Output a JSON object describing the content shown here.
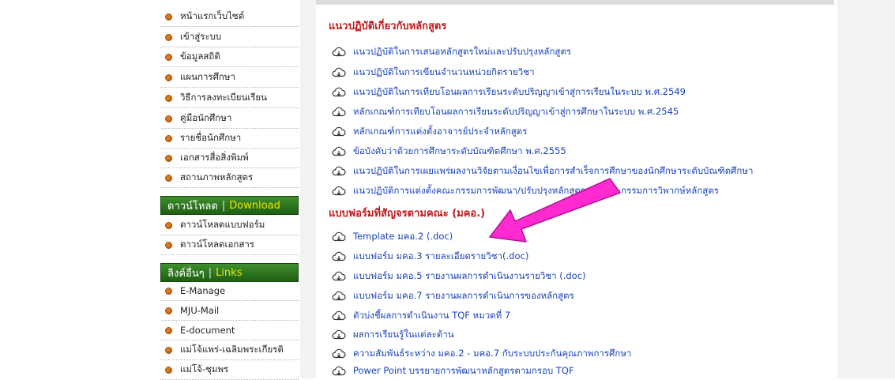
{
  "sidebar": {
    "items": [
      {
        "label": "หน้าแรกเว็บไซต์"
      },
      {
        "label": "เข้าสู่ระบบ"
      },
      {
        "label": "ข้อมูลสถิติ"
      },
      {
        "label": "แผนการศึกษา"
      },
      {
        "label": "วิธีการลงทะเบียนเรียน"
      },
      {
        "label": "คู่มือนักศึกษา"
      },
      {
        "label": "รายชื่อนักศึกษา"
      },
      {
        "label": "เอกสารสื่อสิ่งพิมพ์"
      },
      {
        "label": "สถานภาพหลักสูตร"
      }
    ],
    "download_header": {
      "th": "ดาวน์โหลด",
      "sep": "|",
      "en": "Download"
    },
    "download_items": [
      {
        "label": "ดาวน์โหลดแบบฟอร์ม"
      },
      {
        "label": "ดาวน์โหลดเอกสาร"
      }
    ],
    "links_header": {
      "th": "ลิงค์อื่นๆ",
      "sep": "|",
      "en": "Links"
    },
    "link_items": [
      {
        "label": "E-Manage"
      },
      {
        "label": "MJU-Mail"
      },
      {
        "label": "E-document"
      },
      {
        "label": "แม่โจ้แพร่-เฉลิมพระเกียรติ"
      },
      {
        "label": "แม่โจ้-ชุมพร"
      }
    ]
  },
  "main": {
    "section1_title": "แนวปฏิบัติเกี่ยวกับหลักสูตร",
    "section1_links": [
      {
        "label": "แนวปฏิบัติในการเสนอหลักสูตรใหม่และปรับปรุงหลักสูตร"
      },
      {
        "label": "แนวปฏิบัติในการเขียนจำนวนหน่วยกิตรายวิชา"
      },
      {
        "label": "แนวปฏิบัติในการเทียบโอนผลการเรียนระดับปริญญาเข้าสู่การเรียนในระบบ พ.ศ.2549"
      },
      {
        "label": "หลักเกณฑ์การเทียบโอนผลการเรียนระดับปริญญาเข้าสู่การศึกษาในระบบ พ.ศ.2545"
      },
      {
        "label": "หลักเกณฑ์การแต่งตั้งอาจารย์ประจำหลักสูตร"
      },
      {
        "label": "ข้อบังคับว่าด้วยการศึกษาระดับบัณฑิตศึกษา พ.ศ.2555"
      },
      {
        "label": "แนวปฏิบัติในการเผยแพร่ผลงานวิจัยตามเงื่อนไขเพื่อการสำเร็จการศึกษาของนักศึกษาระดับบัณฑิตศึกษา"
      },
      {
        "label": "แนวปฏิบัติการแต่งตั้งคณะกรรมการพัฒนา/ปรับปรุงหลักสูตรและคณะกรรมการวิพากษ์หลักสูตร"
      }
    ],
    "section2_title": "แบบฟอร์มที่สัญจรตามคณะ (มคอ.)",
    "section2_links": [
      {
        "label": "Template มคอ.2 (.doc)"
      },
      {
        "label": "แบบฟอร์ม มคอ.3 รายละเอียดรายวิชา(.doc)"
      },
      {
        "label": "แบบฟอร์ม มคอ.5 รายงานผลการดำเนินงานรายวิชา (.doc)"
      },
      {
        "label": "แบบฟอร์ม มคอ.7 รายงานผลการดำเนินการของหลักสูตร"
      },
      {
        "label": "ตัวบ่งชี้ผลการดำเนินงาน TQF หมวดที่ 7"
      },
      {
        "label": "ผลการเรียนรู้ในแต่ละด้าน"
      },
      {
        "label": "ความสัมพันธ์ระหว่าง มคอ.2 - มคอ.7 กับระบบประกันคุณภาพการศึกษา"
      },
      {
        "label": "Power Point บรรยายการพัฒนาหลักสูตรตามกรอบ TQF"
      }
    ]
  },
  "colors": {
    "section_title": "#c0191b",
    "link": "#1a44b8",
    "header_bg": "#2e7a22",
    "header_accent": "#f0e300",
    "annotation_arrow": "#ff2bd0"
  },
  "icons": {
    "link_icon": "cloud-download-icon",
    "bullet_icon": "orange-bullet-icon",
    "annotation": "arrow-annotation-icon"
  }
}
